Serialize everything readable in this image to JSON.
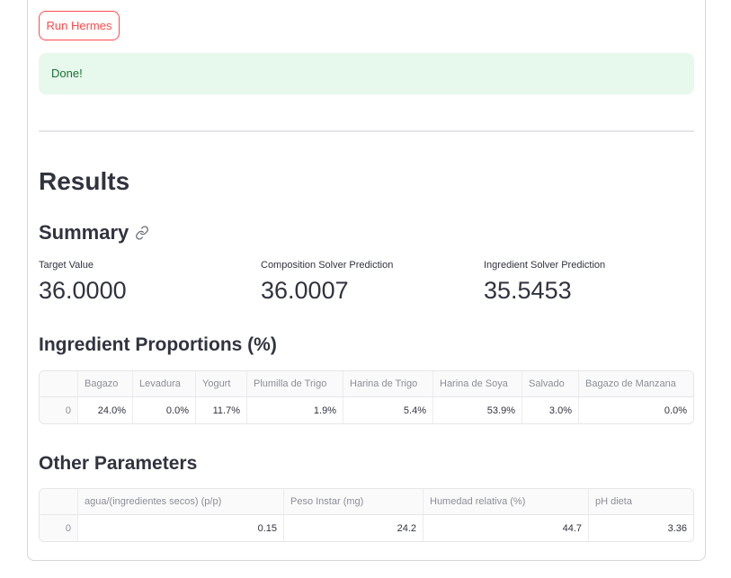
{
  "run_button": {
    "label": "Run Hermes"
  },
  "status": {
    "message": "Done!"
  },
  "results": {
    "title": "Results",
    "summary_title": "Summary",
    "metrics": [
      {
        "label": "Target Value",
        "value": "36.0000"
      },
      {
        "label": "Composition Solver Prediction",
        "value": "36.0007"
      },
      {
        "label": "Ingredient Solver Prediction",
        "value": "35.5453"
      }
    ]
  },
  "ingredients": {
    "title": "Ingredient Proportions (%)",
    "columns": [
      "",
      "Bagazo",
      "Levadura",
      "Yogurt",
      "Plumilla de Trigo",
      "Harina de Trigo",
      "Harina de Soya",
      "Salvado",
      "Bagazo de Manzana"
    ],
    "rows": [
      [
        "0",
        "24.0%",
        "0.0%",
        "11.7%",
        "1.9%",
        "5.4%",
        "53.9%",
        "3.0%",
        "0.0%"
      ]
    ]
  },
  "other": {
    "title": "Other Parameters",
    "columns": [
      "",
      "agua/(ingredientes secos) (p/p)",
      "Peso Instar (mg)",
      "Humedad relativa (%)",
      "pH dieta"
    ],
    "rows": [
      [
        "0",
        "0.15",
        "24.2",
        "44.7",
        "3.36"
      ]
    ]
  },
  "icons": {
    "anchor": "link-icon"
  }
}
